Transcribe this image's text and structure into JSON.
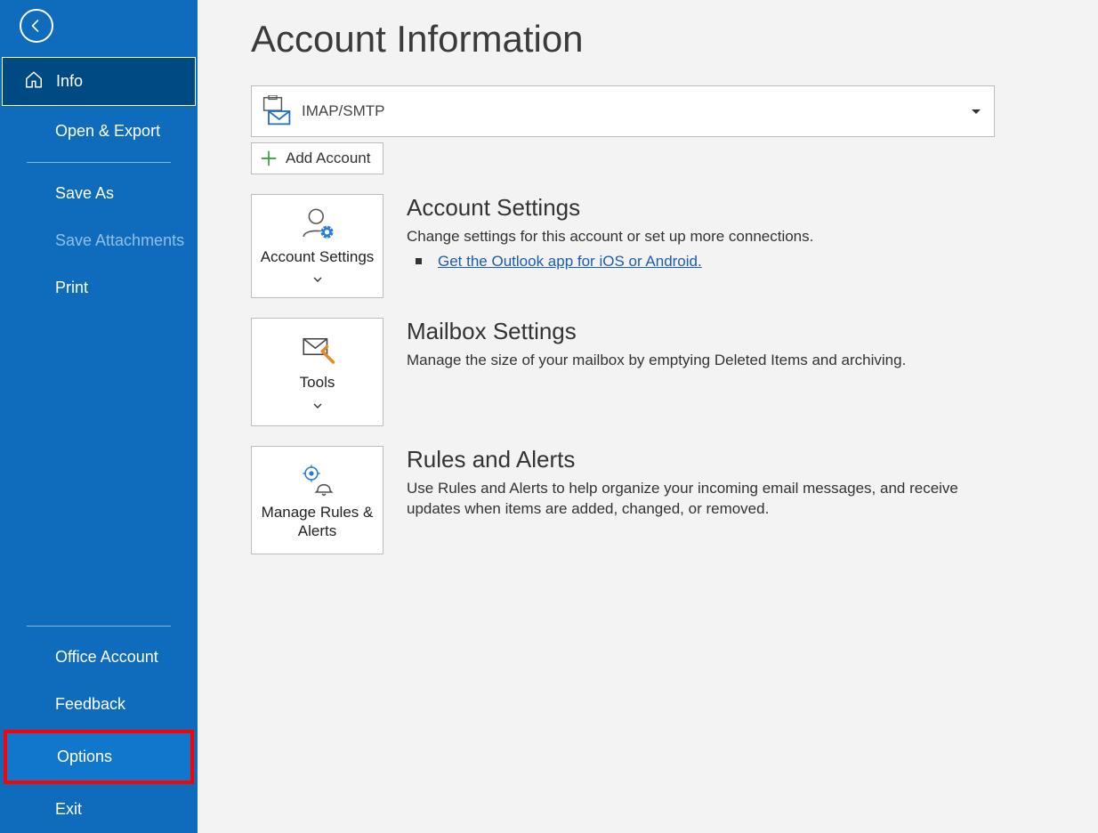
{
  "sidebar": {
    "info": "Info",
    "open_export": "Open & Export",
    "save_as": "Save As",
    "save_attachments": "Save Attachments",
    "print": "Print",
    "office_account": "Office Account",
    "feedback": "Feedback",
    "options": "Options",
    "exit": "Exit"
  },
  "main": {
    "title": "Account Information",
    "account_type": "IMAP/SMTP",
    "add_account": "Add Account",
    "sections": {
      "account_settings": {
        "card": "Account Settings",
        "heading": "Account Settings",
        "desc": "Change settings for this account or set up more connections.",
        "link": "Get the Outlook app for iOS or Android."
      },
      "mailbox": {
        "card": "Tools",
        "heading": "Mailbox Settings",
        "desc": "Manage the size of your mailbox by emptying Deleted Items and archiving."
      },
      "rules": {
        "card": "Manage Rules & Alerts",
        "heading": "Rules and Alerts",
        "desc": "Use Rules and Alerts to help organize your incoming email messages, and receive updates when items are added, changed, or removed."
      }
    }
  }
}
